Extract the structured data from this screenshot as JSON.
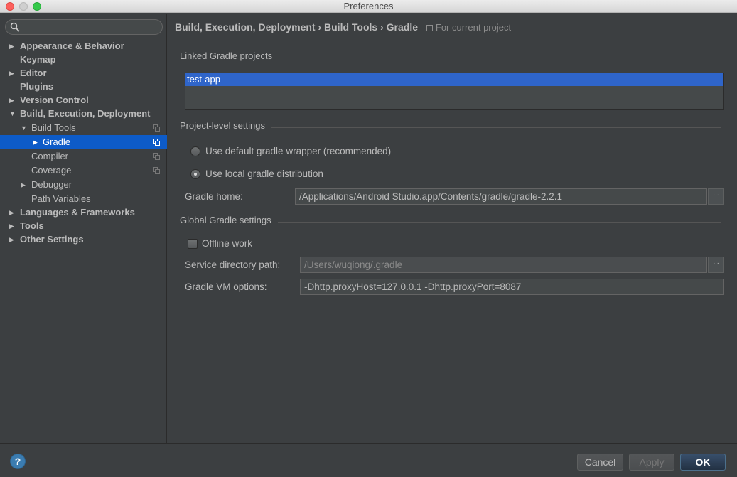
{
  "window": {
    "title": "Preferences"
  },
  "sidebar": {
    "search_placeholder": "",
    "items": [
      {
        "label": "Appearance & Behavior",
        "arrow": "▶"
      },
      {
        "label": "Keymap",
        "arrow": ""
      },
      {
        "label": "Editor",
        "arrow": "▶"
      },
      {
        "label": "Plugins",
        "arrow": ""
      },
      {
        "label": "Version Control",
        "arrow": "▶"
      },
      {
        "label": "Build, Execution, Deployment",
        "arrow": "▼"
      },
      {
        "label": "Build Tools",
        "arrow": "▼"
      },
      {
        "label": "Gradle",
        "arrow": "▶"
      },
      {
        "label": "Compiler",
        "arrow": ""
      },
      {
        "label": "Coverage",
        "arrow": ""
      },
      {
        "label": "Debugger",
        "arrow": "▶"
      },
      {
        "label": "Path Variables",
        "arrow": ""
      },
      {
        "label": "Languages & Frameworks",
        "arrow": "▶"
      },
      {
        "label": "Tools",
        "arrow": "▶"
      },
      {
        "label": "Other Settings",
        "arrow": "▶"
      }
    ]
  },
  "breadcrumb": {
    "path": "Build, Execution, Deployment › Build Tools › Gradle",
    "scope": "For current project"
  },
  "linked_projects": {
    "title": "Linked Gradle projects",
    "items": [
      "test-app"
    ]
  },
  "project_settings": {
    "title": "Project-level settings",
    "option_wrapper": "Use default gradle wrapper (recommended)",
    "option_local": "Use local gradle distribution",
    "selected": "Use local gradle distribution",
    "gradle_home_label": "Gradle home:",
    "gradle_home_value": "/Applications/Android Studio.app/Contents/gradle/gradle-2.2.1",
    "browse_label": "..."
  },
  "global_settings": {
    "title": "Global Gradle settings",
    "offline_label": "Offline work",
    "offline_checked": false,
    "service_dir_label": "Service directory path:",
    "service_dir_value": "/Users/wuqiong/.gradle",
    "vm_options_label": "Gradle VM options:",
    "vm_options_value": "-Dhttp.proxyHost=127.0.0.1 -Dhttp.proxyPort=8087",
    "browse_label": "..."
  },
  "footer": {
    "help_label": "?",
    "cancel_label": "Cancel",
    "apply_label": "Apply",
    "ok_label": "OK"
  },
  "colors": {
    "background": "#3c3f41",
    "selection": "#0d5bc8",
    "list_selection": "#2f65ca",
    "text": "#bbbbbb"
  }
}
